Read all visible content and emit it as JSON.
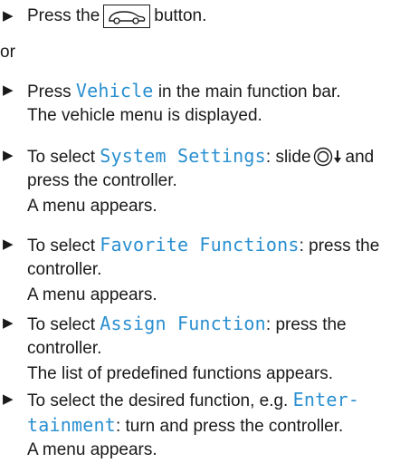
{
  "steps": [
    {
      "pre": "Press the",
      "post": "button.",
      "icon": "vehicle-button-icon"
    },
    {
      "or": "or"
    },
    {
      "line1_pre": "Press ",
      "line1_hl": "Vehicle",
      "line1_post": " in the main function bar.",
      "line2": "The vehicle menu is displayed."
    },
    {
      "line1_pre": "To select ",
      "line1_hl": "System Settings",
      "line1_post": ": slide",
      "line1_post2": "and",
      "line2": "press the controller.",
      "line3": "A menu appears.",
      "icon": "controller-slide-down-icon"
    },
    {
      "line1_pre": "To select ",
      "line1_hl": "Favorite Functions",
      "line1_post": ": press the",
      "line2": "controller.",
      "line3": "A menu appears."
    },
    {
      "line1_pre": "To select ",
      "line1_hl": "Assign Function",
      "line1_post": ": press the",
      "line2": "controller.",
      "line3": "The list of predefined functions appears."
    },
    {
      "line1_pre": "To select the desired function, e.g. ",
      "line1_hl": "Enter-",
      "line2_hl": "tainment",
      "line2_post": ": turn and press the controller.",
      "line3": "A menu appears."
    }
  ],
  "bullet_glyph": "▶"
}
